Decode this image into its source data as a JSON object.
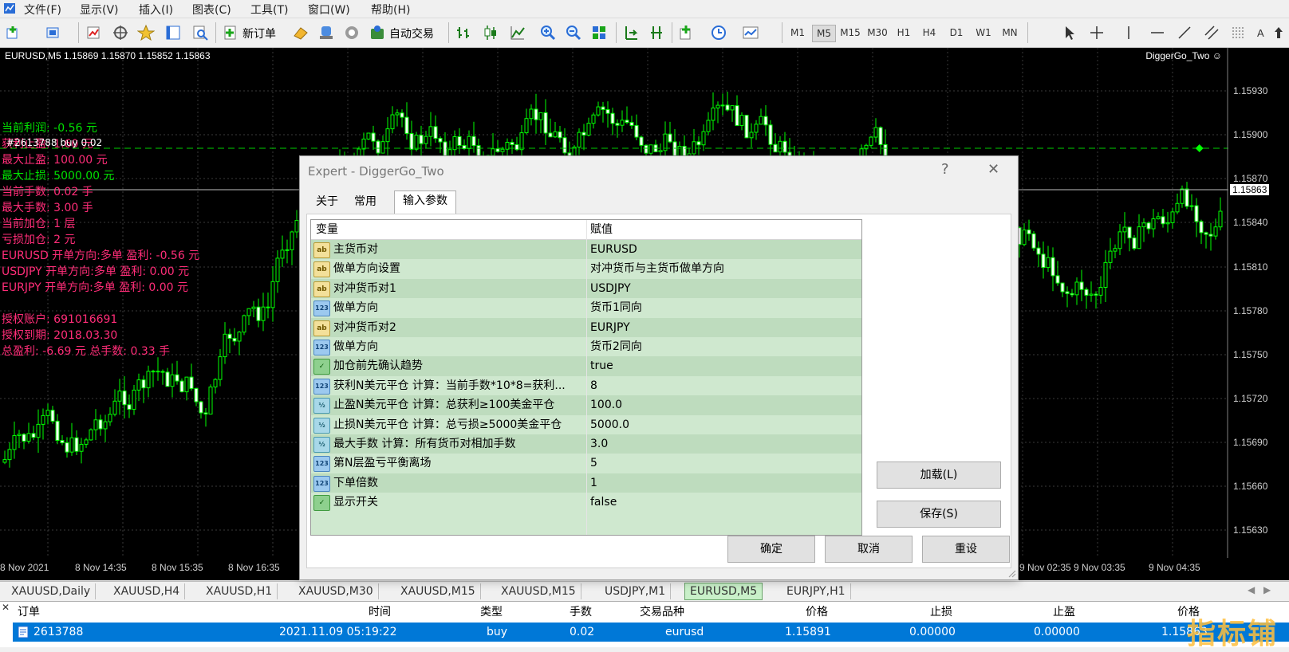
{
  "menu": [
    "文件(F)",
    "显示(V)",
    "插入(I)",
    "图表(C)",
    "工具(T)",
    "窗口(W)",
    "帮助(H)"
  ],
  "toolbar": {
    "new_order": "新订单",
    "auto_trade": "自动交易",
    "timeframes": [
      "M1",
      "M5",
      "M15",
      "M30",
      "H1",
      "H4",
      "D1",
      "W1",
      "MN"
    ],
    "active_timeframe": "M5"
  },
  "chart": {
    "header": "EURUSD,M5  1.15869 1.15870 1.15852 1.15863",
    "ea_name": "DiggerGo_Two",
    "trade_line_label": "#2613788 buy 0.02",
    "info_lines": [
      {
        "text": "当前利润: -0.56 元",
        "color": "green"
      },
      {
        "text": "获利止盈: 1.60 元",
        "color": "pink"
      },
      {
        "text": "最大止盈: 100.00 元",
        "color": "pink"
      },
      {
        "text": "最大止损: 5000.00 元",
        "color": "green"
      },
      {
        "text": "当前手数: 0.02 手",
        "color": "pink"
      },
      {
        "text": "最大手数: 3.00 手",
        "color": "pink"
      },
      {
        "text": "当前加仓: 1 层",
        "color": "pink"
      },
      {
        "text": "亏损加仓: 2 元",
        "color": "pink"
      },
      {
        "text": "EURUSD  开单方向:多单  盈利: -0.56 元",
        "color": "pink"
      },
      {
        "text": "USDJPY  开单方向:多单  盈利: 0.00 元",
        "color": "pink"
      },
      {
        "text": "EURJPY  开单方向:多单  盈利: 0.00 元",
        "color": "pink"
      },
      {
        "text": "授权账户: 691016691",
        "color": "pink"
      },
      {
        "text": "授权到期: 2018.03.30",
        "color": "pink"
      },
      {
        "text": "总盈利: -6.69 元 总手数: 0.33 手",
        "color": "pink"
      }
    ],
    "price_labels": [
      "1.15930",
      "1.15900",
      "1.15870",
      "1.15840",
      "1.15810",
      "1.15780",
      "1.15750",
      "1.15720",
      "1.15690",
      "1.15660",
      "1.15630"
    ],
    "current_price": "1.15863",
    "time_labels_left": [
      "8 Nov 2021",
      "8 Nov 14:35",
      "8 Nov 15:35",
      "8 Nov 16:35"
    ],
    "time_labels_right": [
      "9 Nov 02:35",
      "9 Nov 03:35",
      "9 Nov 04:35"
    ]
  },
  "chart_tabs": [
    "XAUUSD,Daily",
    "XAUUSD,H4",
    "XAUUSD,H1",
    "XAUUSD,M30",
    "XAUUSD,M15",
    "XAUUSD,M15",
    "USDJPY,M1",
    "EURUSD,M5",
    "EURJPY,H1"
  ],
  "active_chart_tab": "EURUSD,M5",
  "orders": {
    "columns": [
      "订单",
      "时间",
      "类型",
      "手数",
      "交易品种",
      "价格",
      "止损",
      "止盈",
      "价格"
    ],
    "row": [
      "2613788",
      "2021.11.09 05:19:22",
      "buy",
      "0.02",
      "eurusd",
      "1.15891",
      "0.00000",
      "0.00000",
      "1.15863"
    ]
  },
  "dialog": {
    "title": "Expert - DiggerGo_Two",
    "help": "?",
    "close": "✕",
    "tabs": [
      "关于",
      "常用",
      "输入参数"
    ],
    "active_tab": "输入参数",
    "columns": [
      "变量",
      "赋值"
    ],
    "params": [
      {
        "type": "ab",
        "name": "主货币对",
        "value": "EURUSD"
      },
      {
        "type": "ab",
        "name": "做单方向设置",
        "value": "对冲货币与主货币做单方向"
      },
      {
        "type": "ab",
        "name": "对冲货币对1",
        "value": "USDJPY"
      },
      {
        "type": "123",
        "name": "做单方向",
        "value": "货币1同向"
      },
      {
        "type": "ab",
        "name": "对冲货币对2",
        "value": "EURJPY"
      },
      {
        "type": "123",
        "name": "做单方向",
        "value": "货币2同向"
      },
      {
        "type": "bool",
        "name": "加仓前先确认趋势",
        "value": "true"
      },
      {
        "type": "123",
        "name": "获利N美元平仓  计算：当前手数*10*8=获利...",
        "value": "8"
      },
      {
        "type": "v12",
        "name": "止盈N美元平仓  计算：总获利≥100美金平仓",
        "value": "100.0"
      },
      {
        "type": "v12",
        "name": "止损N美元平仓  计算：总亏损≥5000美金平仓",
        "value": "5000.0"
      },
      {
        "type": "v12",
        "name": "最大手数          计算：所有货币对相加手数",
        "value": "3.0"
      },
      {
        "type": "123",
        "name": "第N层盈亏平衡离场",
        "value": "5"
      },
      {
        "type": "123",
        "name": "下单倍数",
        "value": "1"
      },
      {
        "type": "bool",
        "name": "显示开关",
        "value": "false"
      }
    ],
    "buttons": {
      "load": "加载(L)",
      "save": "保存(S)",
      "ok": "确定",
      "cancel": "取消",
      "reset": "重设"
    }
  },
  "watermark": "指标铺"
}
